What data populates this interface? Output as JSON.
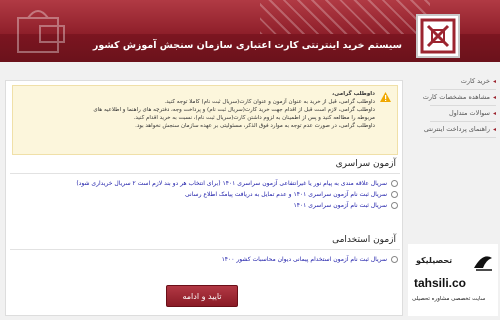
{
  "header": {
    "title": "سیستم خرید اینترنتی کارت اعتباری سازمان سنجش آموزش کشور"
  },
  "sidebar": {
    "items": [
      {
        "label": "خرید کارت"
      },
      {
        "label": "مشاهده مشخصات کارت"
      },
      {
        "label": "سوالات متداول"
      },
      {
        "label": "راهنمای پرداخت اینترنتی"
      }
    ]
  },
  "notice": {
    "lines": [
      "داوطلب گرامی،",
      "داوطلب گرامی، قبل از خرید به عنوان آزمون و عنوان کارت(سریال ثبت نام) کاملا توجه کنید.",
      "داوطلب گرامی، لازم است قبل از اقدام جهت خرید کارت(سریال ثبت نام) و پرداخت وجه، دفترچه های راهنما و اطلاعیه های",
      "مربوطه را مطالعه کنید و پس از اطمینان به لزوم داشتن کارت(سریال ثبت نام)، نسبت به خرید اقدام کنید.",
      "داوطلب گرامی، در صورت عدم توجه به موارد فوق الذکر، مسئولیتی بر عهده سازمان سنجش نخواهد بود."
    ]
  },
  "sections": [
    {
      "title": "آزمون سراسری",
      "options": [
        "سریال علاقه مندی به پیام نور یا غیرانتفاعی آزمون سراسری ۱۴۰۱ (برای انتخاب هر دو بند لازم است ۲ سریال خریداری شود)",
        "سریال ثبت نام آزمون سراسری ۱۴۰۱ و عدم تمایل به دریافت پیامک اطلاع رسانی",
        "سریال ثبت نام آزمون سراسری ۱۴۰۱"
      ]
    },
    {
      "title": "آزمون استخدامی",
      "options": [
        "سریال ثبت نام آزمون استخدام پیمانی دیوان محاسبات کشور ۱۴۰۰"
      ]
    }
  ],
  "submit_label": "تایید و ادامه",
  "watermark": {
    "fa_name": "تحصیلیکو",
    "domain": "tahsili.co",
    "subtitle": "سایت تخصصی مشاوره تحصیلی"
  },
  "colors": {
    "brand": "#9c2530",
    "link": "#1a1aa8",
    "notice_bg": "#fcf6dc"
  }
}
